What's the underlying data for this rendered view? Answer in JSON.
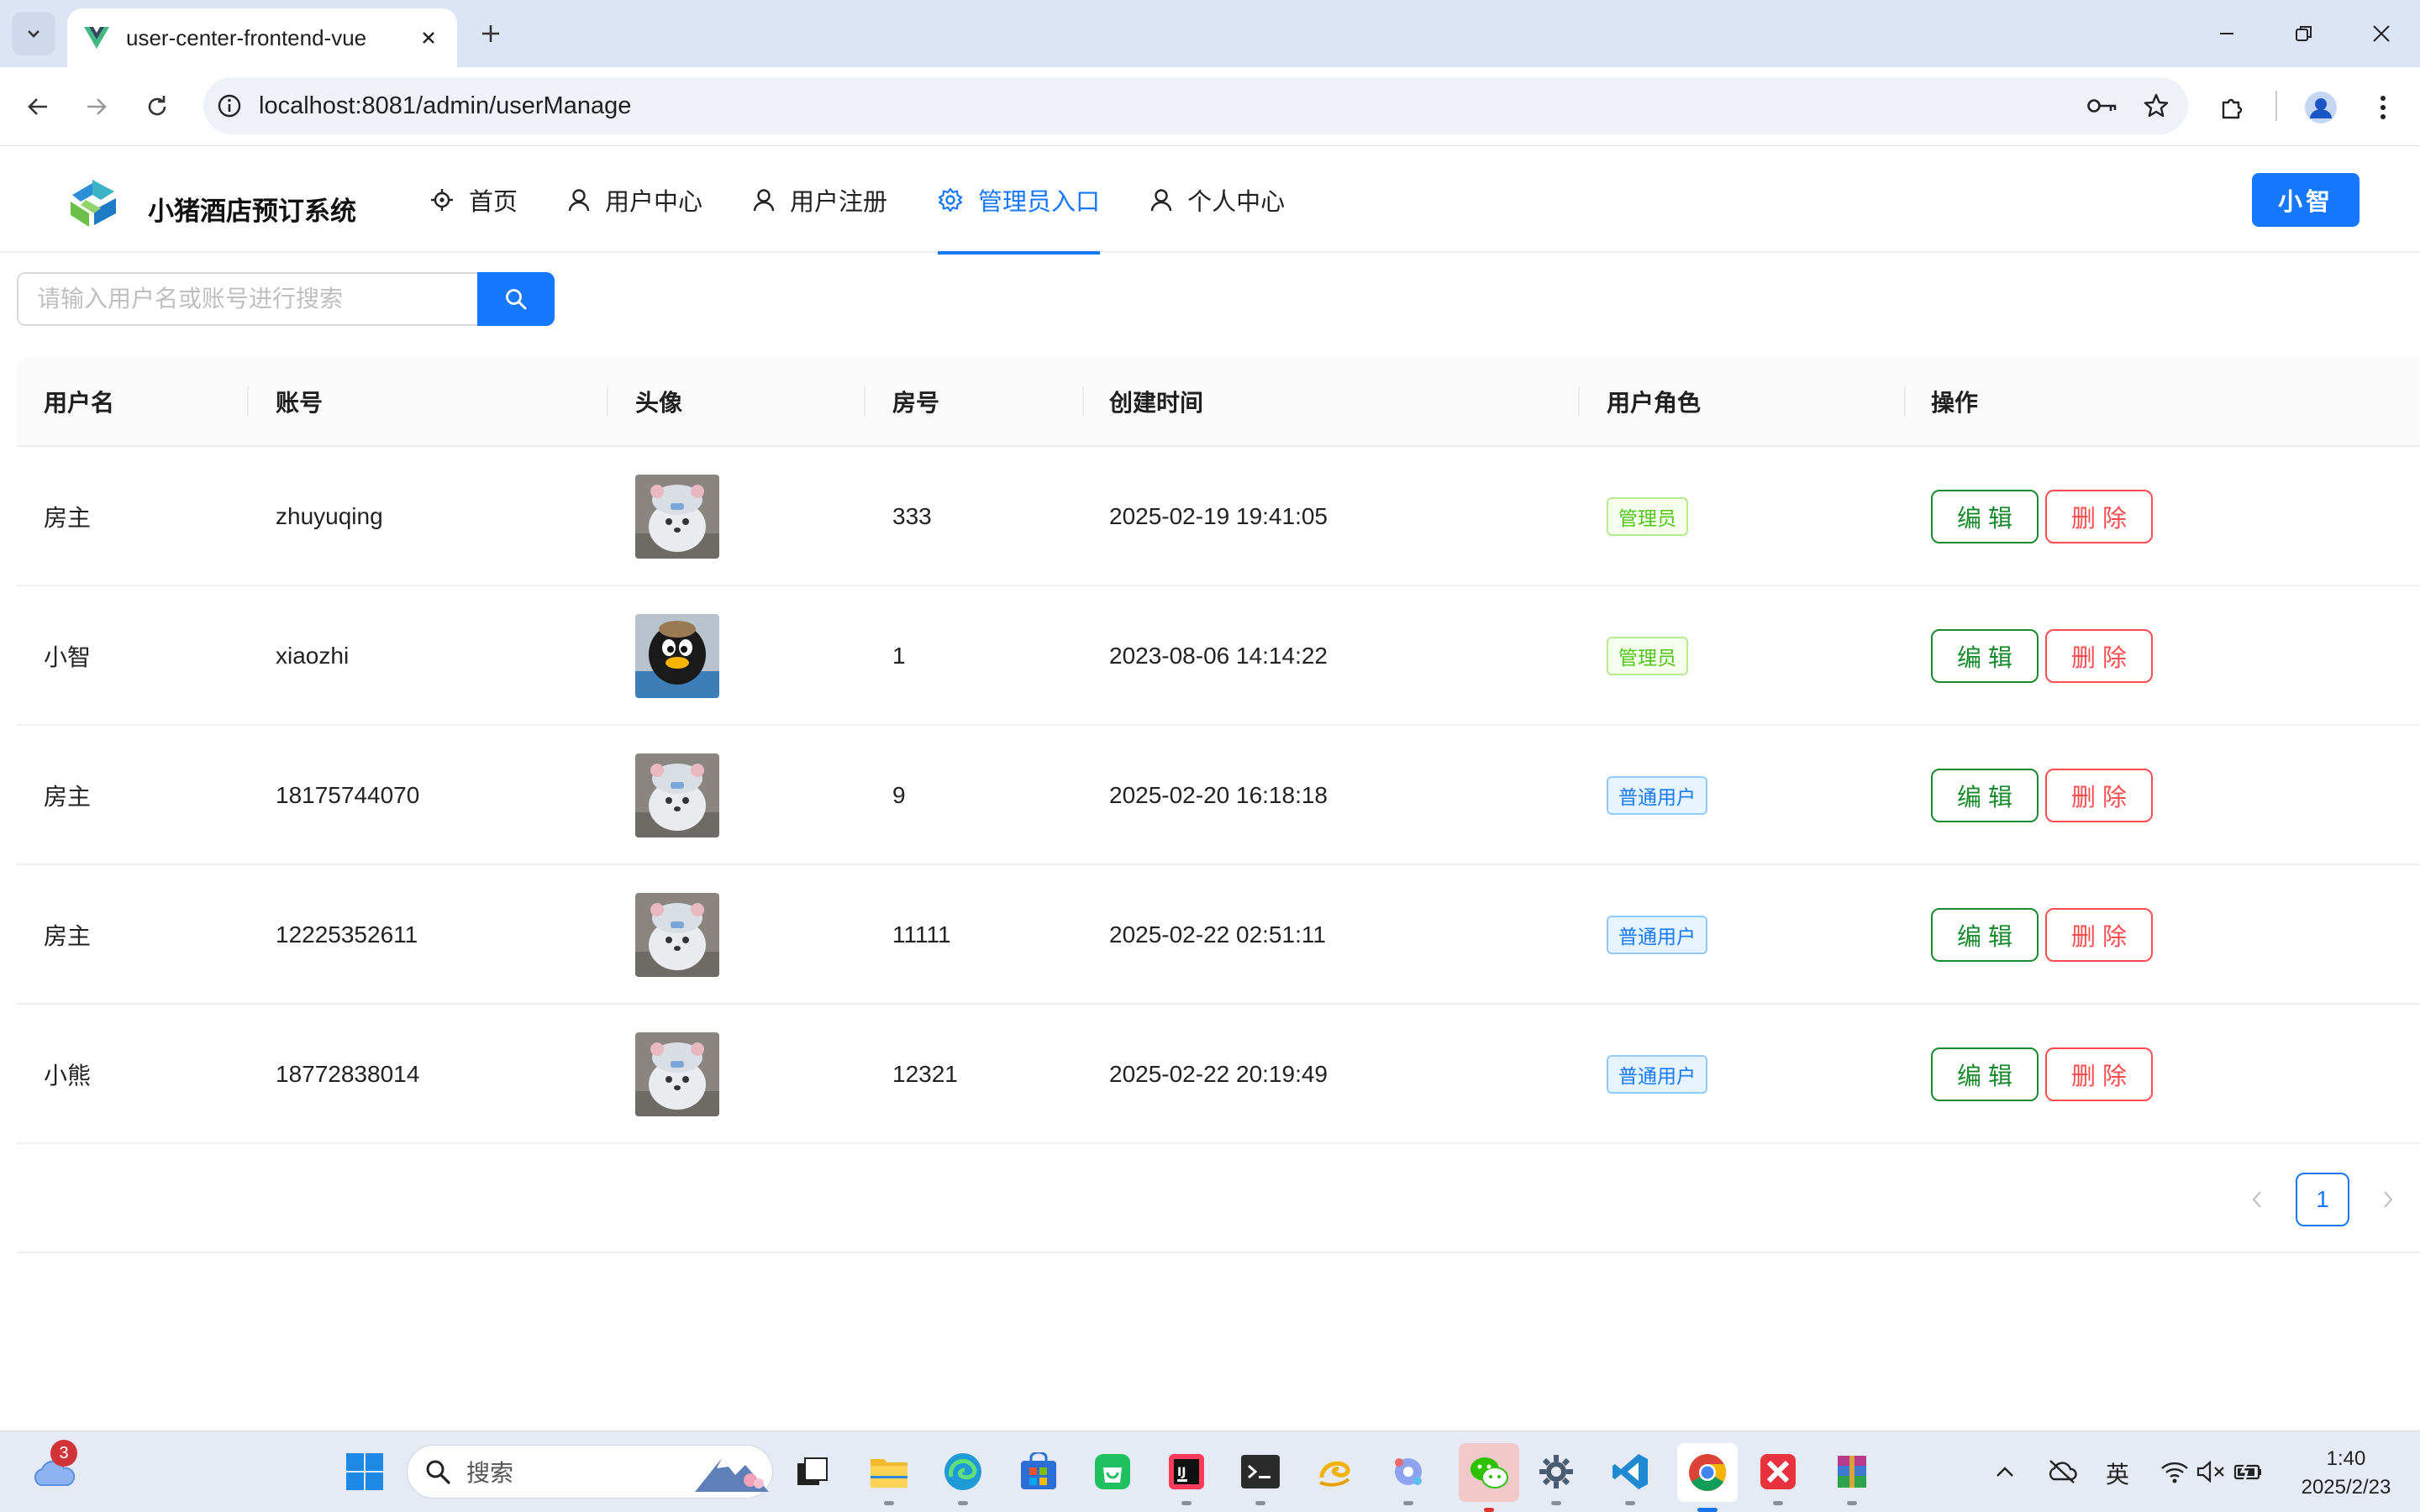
{
  "browser": {
    "tab_title": "user-center-frontend-vue",
    "url": "localhost:8081/admin/userManage"
  },
  "app": {
    "brand": "小猪酒店预订系统",
    "menu": [
      {
        "label": "首页",
        "icon": "home-pin-icon"
      },
      {
        "label": "用户中心",
        "icon": "user-icon"
      },
      {
        "label": "用户注册",
        "icon": "user-icon"
      },
      {
        "label": "管理员入口",
        "icon": "gear-icon",
        "active": true
      },
      {
        "label": "个人中心",
        "icon": "user-icon"
      }
    ],
    "user_button": "小智"
  },
  "search": {
    "placeholder": "请输入用户名或账号进行搜索"
  },
  "table": {
    "columns": [
      "用户名",
      "账号",
      "头像",
      "房号",
      "创建时间",
      "用户角色",
      "操作"
    ],
    "rows": [
      {
        "username": "房主",
        "account": "zhuyuqing",
        "avatar": "plush-avatar",
        "room": "333",
        "created": "2025-02-19 19:41:05",
        "role": "管理员",
        "role_type": "admin"
      },
      {
        "username": "小智",
        "account": "xiaozhi",
        "avatar": "penguin-avatar",
        "room": "1",
        "created": "2023-08-06 14:14:22",
        "role": "管理员",
        "role_type": "admin"
      },
      {
        "username": "房主",
        "account": "18175744070",
        "avatar": "plush-avatar",
        "room": "9",
        "created": "2025-02-20 16:18:18",
        "role": "普通用户",
        "role_type": "user"
      },
      {
        "username": "房主",
        "account": "12225352611",
        "avatar": "plush-avatar",
        "room": "11111",
        "created": "2025-02-22 02:51:11",
        "role": "普通用户",
        "role_type": "user"
      },
      {
        "username": "小熊",
        "account": "18772838014",
        "avatar": "plush-avatar",
        "room": "12321",
        "created": "2025-02-22 20:19:49",
        "role": "普通用户",
        "role_type": "user"
      }
    ],
    "edit_label": "编辑",
    "delete_label": "删除"
  },
  "pagination": {
    "current_page": "1"
  },
  "taskbar": {
    "weather_badge": "3",
    "search_label": "搜索",
    "ime": "英",
    "time": "1:40",
    "date": "2025/2/23"
  },
  "colors": {
    "primary": "#1677ff",
    "edit": "#1a8a2e",
    "delete": "#ff4d4f",
    "admin_tag": "#52c41a",
    "user_tag": "#1677ff"
  }
}
